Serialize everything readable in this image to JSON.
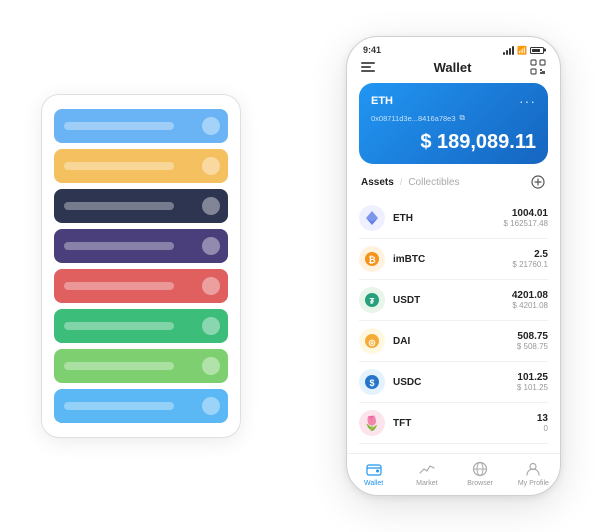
{
  "scene": {
    "card_stack": {
      "cards": [
        {
          "color": "#6AB4F5",
          "label": ""
        },
        {
          "color": "#F5C060",
          "label": ""
        },
        {
          "color": "#2D3550",
          "label": ""
        },
        {
          "color": "#4A3F7A",
          "label": ""
        },
        {
          "color": "#E06060",
          "label": ""
        },
        {
          "color": "#3DBD7A",
          "label": ""
        },
        {
          "color": "#7DCF70",
          "label": ""
        },
        {
          "color": "#5BB8F5",
          "label": ""
        }
      ]
    },
    "phone": {
      "status_bar": {
        "time": "9:41"
      },
      "header": {
        "title": "Wallet"
      },
      "eth_card": {
        "label": "ETH",
        "address": "0x08711d3e...8416a78e3",
        "balance": "$ 189,089.11"
      },
      "tabs": {
        "active": "Assets",
        "inactive": "Collectibles",
        "divider": "/"
      },
      "assets": [
        {
          "symbol": "ETH",
          "amount": "1004.01",
          "usd": "$ 162517.48",
          "color": "#627EEA",
          "icon": "◈"
        },
        {
          "symbol": "imBTC",
          "amount": "2.5",
          "usd": "$ 21760.1",
          "color": "#F7931A",
          "icon": "₿"
        },
        {
          "symbol": "USDT",
          "amount": "4201.08",
          "usd": "$ 4201.08",
          "color": "#26A17B",
          "icon": "₮"
        },
        {
          "symbol": "DAI",
          "amount": "508.75",
          "usd": "$ 508.75",
          "color": "#F5AC37",
          "icon": "◎"
        },
        {
          "symbol": "USDC",
          "amount": "101.25",
          "usd": "$ 101.25",
          "color": "#2775CA",
          "icon": "$"
        },
        {
          "symbol": "TFT",
          "amount": "13",
          "usd": "0",
          "color": "#E64B7B",
          "icon": "🌷"
        }
      ],
      "bottom_nav": [
        {
          "label": "Wallet",
          "active": true
        },
        {
          "label": "Market",
          "active": false
        },
        {
          "label": "Browser",
          "active": false
        },
        {
          "label": "My Profile",
          "active": false
        }
      ]
    }
  }
}
